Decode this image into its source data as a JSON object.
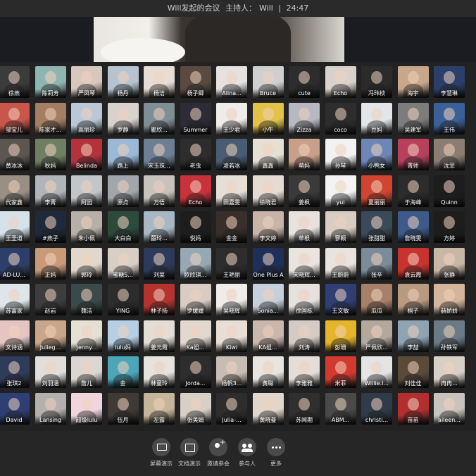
{
  "meeting": {
    "title": "Will发起的会议",
    "host_label": "主持人：",
    "host_name": "Will",
    "separator": "|",
    "duration": "24:47"
  },
  "participants": [
    [
      "徐燕",
      "陈莉芳",
      "严凤琴",
      "杨丹",
      "杨洁",
      "杨子卿",
      "Alina...",
      "Bruce",
      "cute",
      "Echo",
      "冯玮桢",
      "海宇",
      "李慧琳"
    ],
    [
      "邹宝儿",
      "陈家才...",
      "高丽珍",
      "罗静",
      "瞿欣...",
      "Summer",
      "王少君",
      "小牛",
      "Zizza",
      "coco",
      "豆妈",
      "吴建军",
      "王伟"
    ],
    [
      "黄冰冰",
      "秋妈",
      "Belinda",
      "路上",
      "宋玉珠...",
      "老虫",
      "凌若冰",
      "鑫鑫",
      "萌妈",
      "孙琴",
      "小鸭女",
      "菁师",
      "沈菲"
    ],
    [
      "代家鑫",
      "李菁",
      "阿园",
      "原点",
      "万悟",
      "Echo",
      "田嘉雯",
      "徐晓君",
      "姜枫",
      "yui",
      "夏丽丽",
      "于海峰",
      "Quinn"
    ],
    [
      "王圣道",
      "#燕子",
      "朱小佩",
      "大白白",
      "囍玲...",
      "悦妈",
      "金金",
      "李文婷",
      "草根",
      "寥颖",
      "张甜甜",
      "詹晓雯",
      "方婷"
    ],
    [
      "AD-LU...",
      "正妈",
      "郭玲",
      "蜜糖S...",
      "刘菜",
      "欧欣琪...",
      "王艳丽",
      "One Plus ABM Leo",
      "宋晓辉...",
      "王蔚蔚",
      "张辛",
      "袁云霞",
      "张静"
    ],
    [
      "苏富家",
      "赵岩",
      "魏洁",
      "YING",
      "林子扬",
      "罗媛媛",
      "吴晓辉",
      "Sonia...",
      "徐国栋",
      "王文敏",
      "瓜瓜",
      "桐子",
      "赫娇娇"
    ],
    [
      "文诗涵",
      "Julieg...",
      "Jenny...",
      "lulu妈",
      "姜元霞",
      "Ka姐...",
      "Kiwi",
      "KA姐...",
      "刘涛",
      "彭珊",
      "严佩欣...",
      "李喆",
      "孙铁军"
    ],
    [
      "张琪2",
      "刘羽涵",
      "詹儿",
      "金",
      "林童玲",
      "Jorda...",
      "杨帆3...",
      "黄聪",
      "李雅雅",
      "米菲",
      "Willie.l...",
      "刘佳佳",
      "冉冉..."
    ],
    [
      "David",
      "Lansing",
      "超级lulu",
      "伍月",
      "左露",
      "张美娟",
      "Julia-...",
      "黄晓曼",
      "苏闻期",
      "ABM...",
      "christi...",
      "苗苗",
      "aileen..."
    ]
  ],
  "tile_colors": [
    [
      "#3b3b3b",
      "#8fb5b0",
      "#d8c7bd",
      "#b7c3cf",
      "#e8ddd6",
      "#5a4a40",
      "#e6e2e0",
      "#cfcfcf",
      "#2d2d2d",
      "#d9d2cc",
      "#2b2b2b",
      "#c9a78b",
      "#2c3f6b"
    ],
    [
      "#c8564a",
      "#a47e62",
      "#b9c7d6",
      "#d8d2cf",
      "#7f8d95",
      "#2c2c36",
      "#f0ece9",
      "#e3c24a",
      "#b8b8c2",
      "#2d2d2d",
      "#e2e6ea",
      "#7c7c7c",
      "#3b5f99"
    ],
    [
      "#5b5650",
      "#6f7f63",
      "#b3323c",
      "#9bb8d6",
      "#6c7f94",
      "#2d2d2d",
      "#4a5c73",
      "#e5dfd6",
      "#c89f88",
      "#f2f2f2",
      "#6d86b8",
      "#b9405d",
      "#8b7d71"
    ],
    [
      "#9a8f85",
      "#b1b5b9",
      "#c2c6c9",
      "#a1a6aa",
      "#c8c2bc",
      "#c9323a",
      "#e6dfd8",
      "#e4dbd3",
      "#3a3a3a",
      "#f3f3f3",
      "#d14430",
      "#2c2c2c",
      "#1d1d1d"
    ],
    [
      "#d6e2ea",
      "#1e2a3a",
      "#b7b0a8",
      "#2d4a3d",
      "#a7b8c4",
      "#1d1d1d",
      "#3a2e2a",
      "#c8b4a8",
      "#e7e2de",
      "#d8ccc3",
      "#3a4a5a",
      "#3d5a8a",
      "#1d1d1d"
    ],
    [
      "#2d3e6a",
      "#c99a7a",
      "#e2d7cd",
      "#d7cec6",
      "#2d3a5a",
      "#96a8b4",
      "#2d2d2d",
      "#1f2f5a",
      "#e9e4e0",
      "#e8e3df",
      "#7b8b99",
      "#c9332f",
      "#c9b7a6"
    ],
    [
      "#dfe6ea",
      "#3d3d3d",
      "#3a4a4a",
      "#2c2c2c",
      "#b4332f",
      "#d8cbc2",
      "#f0ece9",
      "#c6d0dc",
      "#e6e1dd",
      "#2f3f73",
      "#a88069",
      "#b89a80",
      "#d2b59a"
    ],
    [
      "#e4c5c2",
      "#c9a68a",
      "#e6e0d4",
      "#b6cfe3",
      "#e3ddd6",
      "#e2d8cf",
      "#e8ded5",
      "#c9b7ad",
      "#d6cbc4",
      "#e6b429",
      "#b3a89e",
      "#8fa3b3",
      "#6b7a86"
    ],
    [
      "#2e3b5a",
      "#e0ddda",
      "#dcd6d2",
      "#4aa6b8",
      "#e6e2de",
      "#2d2d2d",
      "#c8bdb5",
      "#e8e4e0",
      "#e5ddd7",
      "#d23a2f",
      "#e4e4e4",
      "#5a4a3a",
      "#d8cfc7"
    ],
    [
      "#2f3f73",
      "#b3b0ad",
      "#f0d6dc",
      "#3f3a36",
      "#c7b59a",
      "#d8cfc6",
      "#2d2d2d",
      "#e1d6cc",
      "#2f2f2f",
      "#4a4a4a",
      "#2f3a4a",
      "#b22f2f",
      "#c8c3bd"
    ]
  ],
  "toolbar": {
    "screen_share": "屏幕演示",
    "doc_share": "文档演示",
    "invite": "邀请参会",
    "participants": "参与人",
    "more": "更多"
  }
}
